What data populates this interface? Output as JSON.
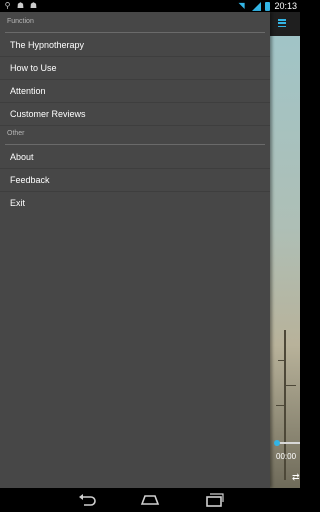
{
  "status_bar": {
    "time": "20:13",
    "left_icons": [
      "usb-icon",
      "android-icon",
      "android-icon"
    ],
    "right_icons": [
      "wifi-icon",
      "signal-icon",
      "battery-icon"
    ],
    "accent": "#33b5e5"
  },
  "drawer": {
    "sections": [
      {
        "header": "Function",
        "items": [
          {
            "label": "The Hypnotherapy"
          },
          {
            "label": "How to Use"
          },
          {
            "label": "Attention"
          },
          {
            "label": "Customer Reviews"
          }
        ]
      },
      {
        "header": "Other",
        "items": [
          {
            "label": "About"
          },
          {
            "label": "Feedback"
          },
          {
            "label": "Exit"
          }
        ]
      }
    ],
    "background": "#474747"
  },
  "player": {
    "time": "00:00"
  },
  "nav_bar": {
    "icons": [
      "back-icon",
      "home-icon",
      "recent-apps-icon"
    ]
  }
}
